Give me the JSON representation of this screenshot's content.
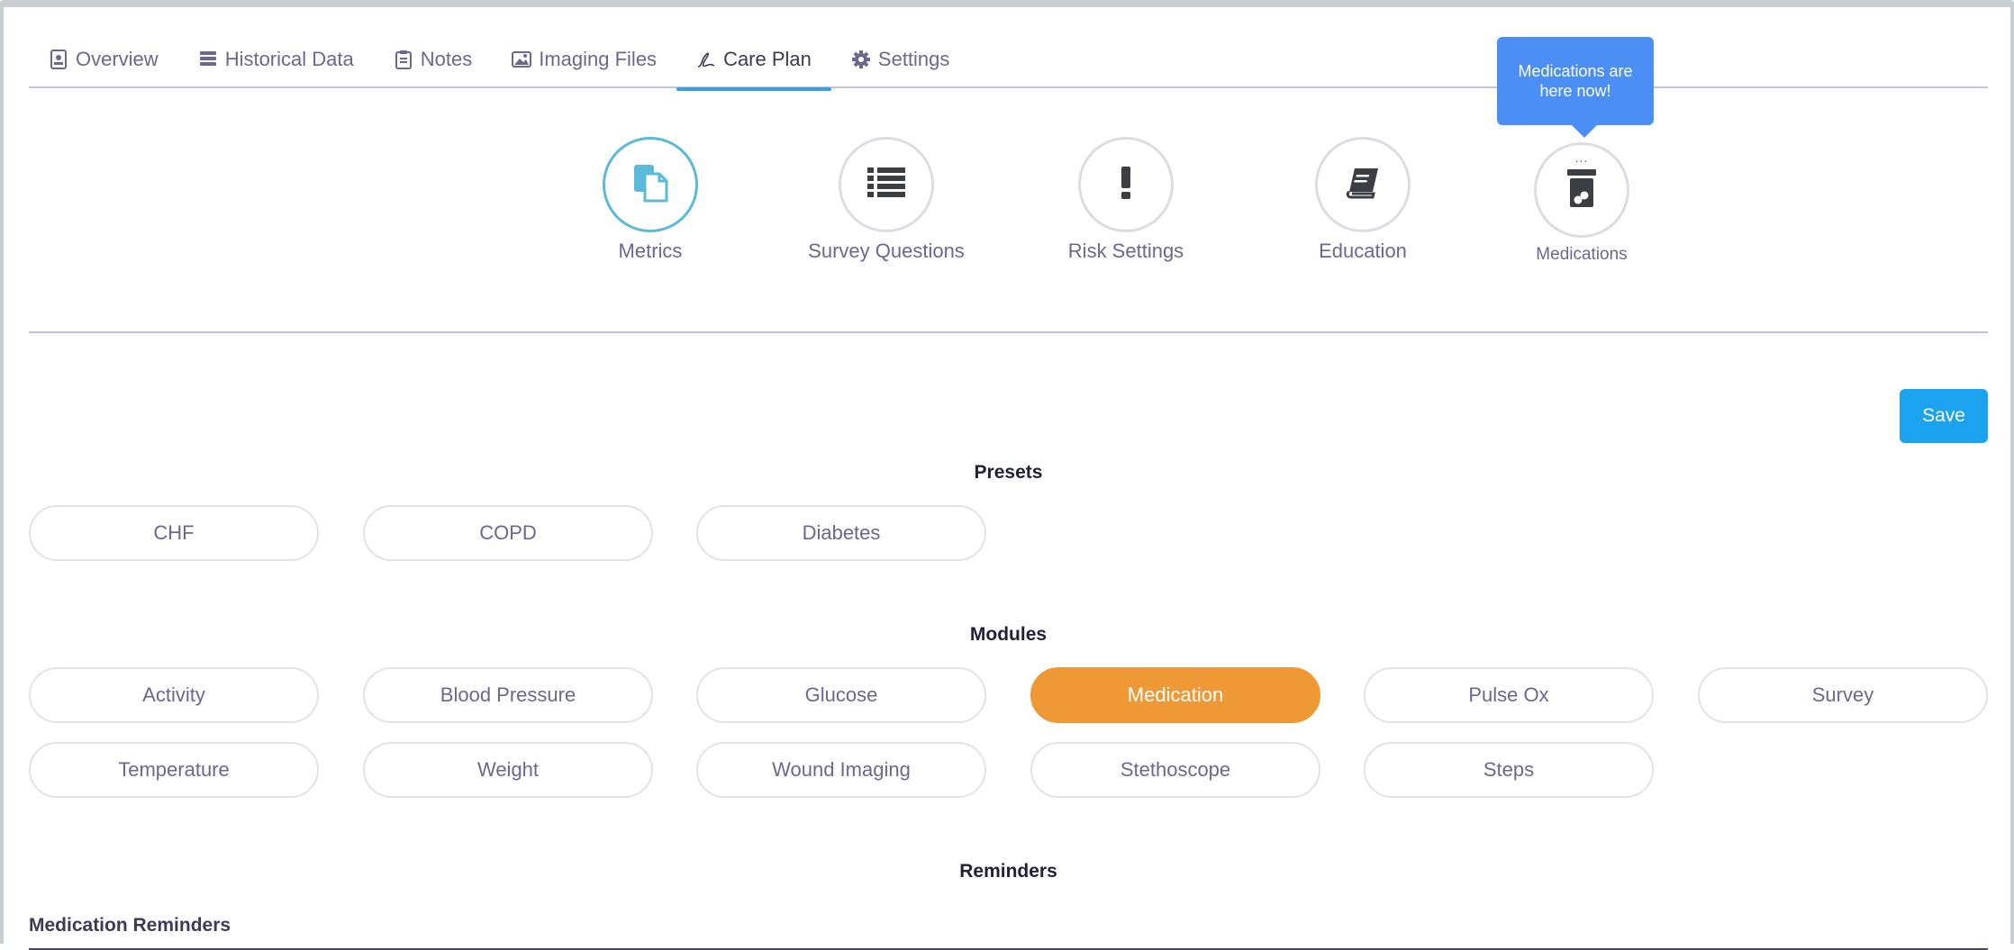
{
  "tabs": [
    {
      "label": "Overview",
      "icon": "id-card-icon"
    },
    {
      "label": "Historical Data",
      "icon": "database-icon"
    },
    {
      "label": "Notes",
      "icon": "clipboard-icon"
    },
    {
      "label": "Imaging Files",
      "icon": "image-icon"
    },
    {
      "label": "Care Plan",
      "icon": "signature-icon",
      "active": true
    },
    {
      "label": "Settings",
      "icon": "gear-icon"
    }
  ],
  "care_nav": [
    {
      "label": "Metrics",
      "icon": "copy-files-icon",
      "active": true
    },
    {
      "label": "Survey Questions",
      "icon": "list-icon"
    },
    {
      "label": "Risk Settings",
      "icon": "exclamation-icon"
    },
    {
      "label": "Education",
      "icon": "book-icon"
    },
    {
      "label": "Medications",
      "icon": "pill-bottle-icon",
      "dots": "..."
    }
  ],
  "tooltip": "Medications are here now!",
  "save_label": "Save",
  "presets": {
    "title": "Presets",
    "items": [
      "CHF",
      "COPD",
      "Diabetes"
    ]
  },
  "modules": {
    "title": "Modules",
    "items": [
      "Activity",
      "Blood Pressure",
      "Glucose",
      "Medication",
      "Pulse Ox",
      "Survey",
      "Temperature",
      "Weight",
      "Wound Imaging",
      "Stethoscope",
      "Steps"
    ],
    "selected": "Medication"
  },
  "reminders": {
    "title": "Reminders",
    "subheading": "Medication Reminders"
  },
  "colors": {
    "accent": "#1ca3ef",
    "active_tab_underline": "#3b9ee2",
    "selected_module": "#ef9836",
    "tooltip": "#4b8ff4",
    "metrics_circle": "#5bbad8"
  }
}
